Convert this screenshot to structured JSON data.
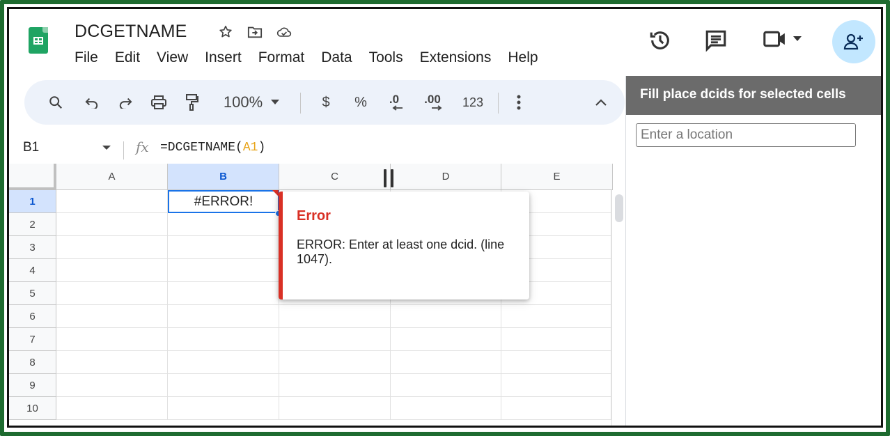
{
  "document": {
    "title": "DCGETNAME"
  },
  "menu": [
    "File",
    "Edit",
    "View",
    "Insert",
    "Format",
    "Data",
    "Tools",
    "Extensions",
    "Help"
  ],
  "toolbar": {
    "zoom": "100%",
    "currency": "$",
    "percent": "%",
    "decrease_decimal": ".0",
    "increase_decimal": ".00",
    "number_format": "123"
  },
  "formula_bar": {
    "name_box": "B1",
    "formula_prefix": "=DCGETNAME(",
    "formula_ref": "A1",
    "formula_suffix": ")"
  },
  "grid": {
    "columns": [
      "A",
      "B",
      "C",
      "D",
      "E"
    ],
    "rows": [
      "1",
      "2",
      "3",
      "4",
      "5",
      "6",
      "7",
      "8",
      "9",
      "10"
    ],
    "active_cell_value": "#ERROR!"
  },
  "error_popup": {
    "title": "Error",
    "message": "ERROR: Enter at least one dcid. (line 1047)."
  },
  "sidebar": {
    "title": "Fill place dcids for selected cells",
    "input_placeholder": "Enter a location"
  },
  "colors": {
    "accent": "#1a73e8",
    "error": "#d93025",
    "sheets_green": "#1fa463",
    "frame_green": "#1e6b30"
  }
}
